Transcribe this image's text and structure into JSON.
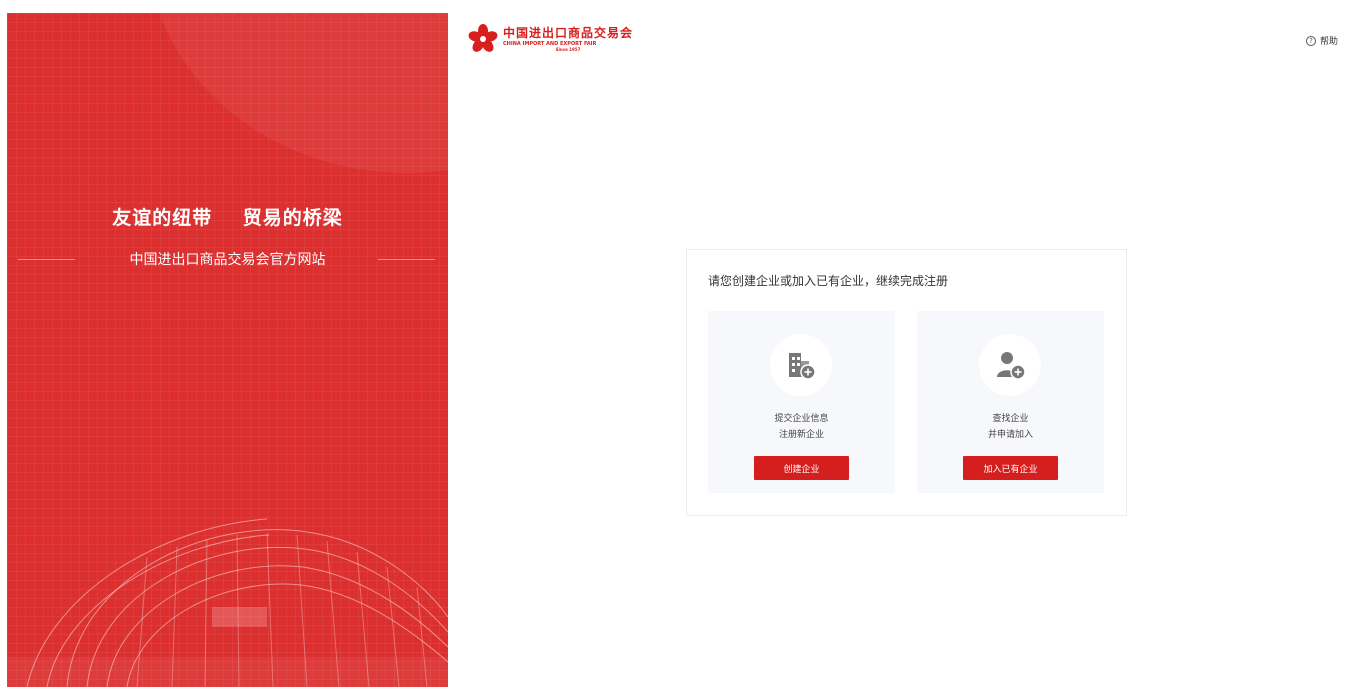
{
  "banner": {
    "title": "友谊的纽带    贸易的桥梁",
    "subtitle": "中国进出口商品交易会官方网站"
  },
  "logo": {
    "cn": "中国进出口商品交易会",
    "en": "CHINA IMPORT AND EXPORT FAIR",
    "since": "Since 1957",
    "brand_color": "#d81e1e"
  },
  "header": {
    "help_label": "帮助",
    "help_icon": "help-circle-icon"
  },
  "card": {
    "title": "请您创建企业或加入已有企业，继续完成注册",
    "options": [
      {
        "icon": "building-add-icon",
        "line1": "提交企业信息",
        "line2": "注册新企业",
        "button": "创建企业"
      },
      {
        "icon": "user-add-icon",
        "line1": "查找企业",
        "line2": "并申请加入",
        "button": "加入已有企业"
      }
    ]
  },
  "colors": {
    "accent": "#d51e1e",
    "banner_bg": "#dc3030",
    "option_bg": "#f7f8fb"
  }
}
